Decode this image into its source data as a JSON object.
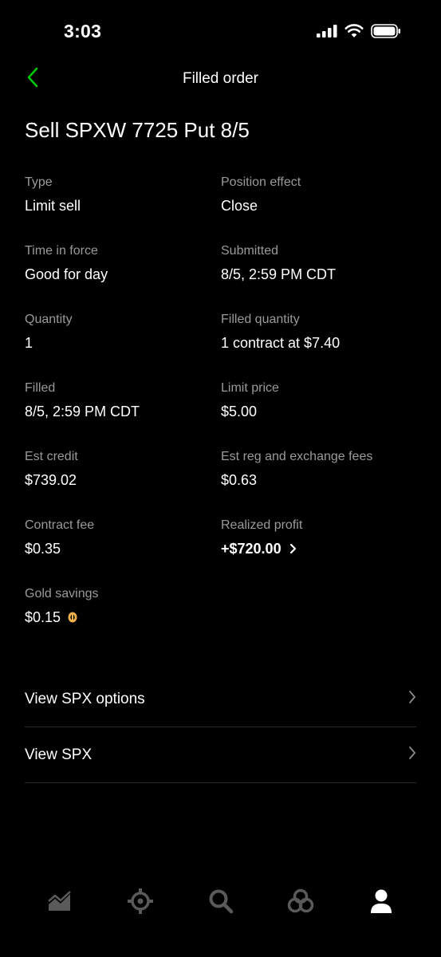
{
  "status_bar": {
    "time": "3:03"
  },
  "header": {
    "title": "Filled order"
  },
  "order": {
    "title": "Sell SPXW 7725 Put 8/5"
  },
  "details": {
    "type": {
      "label": "Type",
      "value": "Limit sell"
    },
    "position_effect": {
      "label": "Position effect",
      "value": "Close"
    },
    "time_in_force": {
      "label": "Time in force",
      "value": "Good for day"
    },
    "submitted": {
      "label": "Submitted",
      "value": "8/5, 2:59 PM CDT"
    },
    "quantity": {
      "label": "Quantity",
      "value": "1"
    },
    "filled_quantity": {
      "label": "Filled quantity",
      "value": "1 contract at $7.40"
    },
    "filled": {
      "label": "Filled",
      "value": "8/5, 2:59 PM CDT"
    },
    "limit_price": {
      "label": "Limit price",
      "value": "$5.00"
    },
    "est_credit": {
      "label": "Est credit",
      "value": "$739.02"
    },
    "est_fees": {
      "label": "Est reg and exchange fees",
      "value": "$0.63"
    },
    "contract_fee": {
      "label": "Contract fee",
      "value": "$0.35"
    },
    "realized_profit": {
      "label": "Realized profit",
      "value": "+$720.00"
    },
    "gold_savings": {
      "label": "Gold savings",
      "value": "$0.15"
    }
  },
  "links": [
    {
      "label": "View SPX options"
    },
    {
      "label": "View SPX"
    }
  ],
  "bottom_nav": [
    "chart-icon",
    "options-icon",
    "search-icon",
    "network-icon",
    "account-icon"
  ],
  "colors": {
    "accent": "#00c805",
    "label_gray": "#9a9a9a",
    "gold": "#f0b04a"
  }
}
